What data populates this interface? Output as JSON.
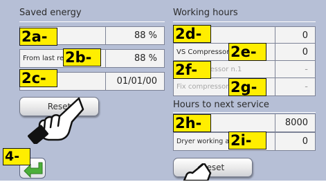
{
  "saved_energy": {
    "title": "Saved energy",
    "rows": [
      {
        "label": "",
        "value": "88 %"
      },
      {
        "label": "From last reset",
        "value": "88 %"
      },
      {
        "label": "",
        "value": "01/01/00"
      }
    ],
    "reset_label": "Reset"
  },
  "working_hours": {
    "title": "Working hours",
    "rows": [
      {
        "label": "",
        "value": "0"
      },
      {
        "label": "VS Compressor",
        "value": "0"
      },
      {
        "label": "Fix compressor n.1",
        "value": "-"
      },
      {
        "label": "Fix compressor",
        "value": "-"
      }
    ]
  },
  "next_service": {
    "title": "Hours to next service",
    "rows": [
      {
        "label": "",
        "value": "8000"
      },
      {
        "label": "Dryer working at last reset",
        "value": "0"
      }
    ],
    "reset_label": "Reset"
  },
  "callouts": [
    "2a-",
    "2b-",
    "2c-",
    "2d-",
    "2e-",
    "2f-",
    "2g-",
    "2h-",
    "2i-",
    "4-"
  ],
  "icons": {
    "back": "back-arrow-icon",
    "hand": "pointing-hand-icon"
  },
  "colors": {
    "background": "#b6bfd6",
    "cell": "#f3f3f3",
    "callout": "#ffee00",
    "back_arrow": "#4caf3a"
  }
}
